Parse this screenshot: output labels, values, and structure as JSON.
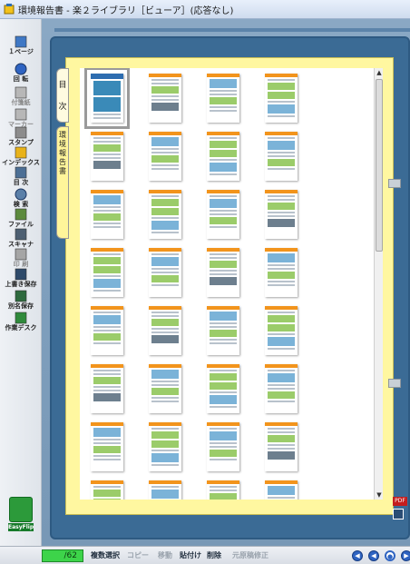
{
  "window": {
    "title": "環境報告書 - 楽２ライブラリ［ビューア］(応答なし)"
  },
  "toolbar": {
    "items": [
      {
        "label": "１ページ",
        "icon": "single-page-icon",
        "enabled": true
      },
      {
        "label": "回 転",
        "icon": "rotate-icon",
        "enabled": true
      },
      {
        "label": "付箋紙",
        "icon": "sticky-note-icon",
        "enabled": false
      },
      {
        "label": "マーカー",
        "icon": "marker-icon",
        "enabled": false
      },
      {
        "label": "スタンプ",
        "icon": "stamp-icon",
        "enabled": true
      },
      {
        "label": "インデックス",
        "icon": "index-icon",
        "enabled": true
      },
      {
        "label": "目 次",
        "icon": "toc-icon",
        "enabled": true
      },
      {
        "label": "検 索",
        "icon": "search-icon",
        "enabled": true
      },
      {
        "label": "ファイル",
        "icon": "file-icon",
        "enabled": true
      },
      {
        "label": "スキャナ",
        "icon": "scanner-icon",
        "enabled": true
      },
      {
        "label": "印 刷",
        "icon": "print-icon",
        "enabled": false
      },
      {
        "label": "上書き保存",
        "icon": "save-icon",
        "enabled": true
      },
      {
        "label": "別名保存",
        "icon": "save-as-icon",
        "enabled": true
      },
      {
        "label": "作業デスク",
        "icon": "desk-icon",
        "enabled": true
      }
    ],
    "logo_label": "EasyFlip"
  },
  "tabs": {
    "toc_label": "目次",
    "report_label": "環境報告書"
  },
  "thumbnails": {
    "count": 32,
    "selected_index": 0
  },
  "corner": {
    "pdf_label": "PDF"
  },
  "status": {
    "page_display": "/62",
    "buttons": [
      {
        "label": "複数選択",
        "enabled": true
      },
      {
        "label": "コピー",
        "enabled": false
      },
      {
        "label": "移動",
        "enabled": false
      },
      {
        "label": "貼付け",
        "enabled": true
      },
      {
        "label": "削除",
        "enabled": true
      },
      {
        "label": "元原稿修正",
        "enabled": false
      }
    ],
    "nav_icons": [
      "first-page-icon",
      "previous-page-icon",
      "stop-icon",
      "next-page-icon"
    ]
  },
  "colors": {
    "accent_page": "#fff7a0",
    "frame": "#3b6b95",
    "page_counter": "#3dd44a"
  }
}
